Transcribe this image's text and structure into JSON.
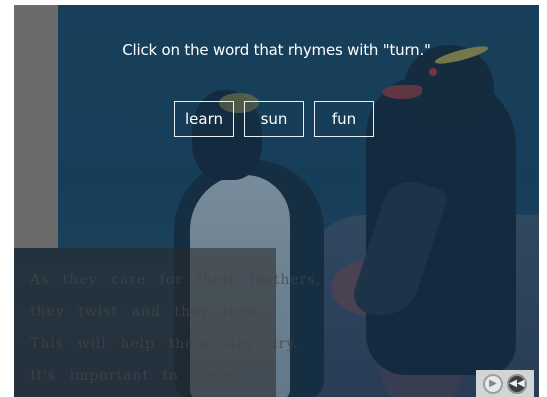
{
  "question": "Click on the word that rhymes with \"turn.\"",
  "choices": [
    "learn",
    "sun",
    "fun"
  ],
  "poem_lines": [
    "As they care for their feathers,",
    "they twist and they turn.",
    "This will help them stay dry.",
    "It's important to learn."
  ],
  "nav": {
    "play_icon": "▶",
    "rewind_icon": "◀◀"
  },
  "colors": {
    "stage_blue": "#204a63",
    "side_panel": "#6b6b6b",
    "choice_border": "#e8eef2"
  }
}
